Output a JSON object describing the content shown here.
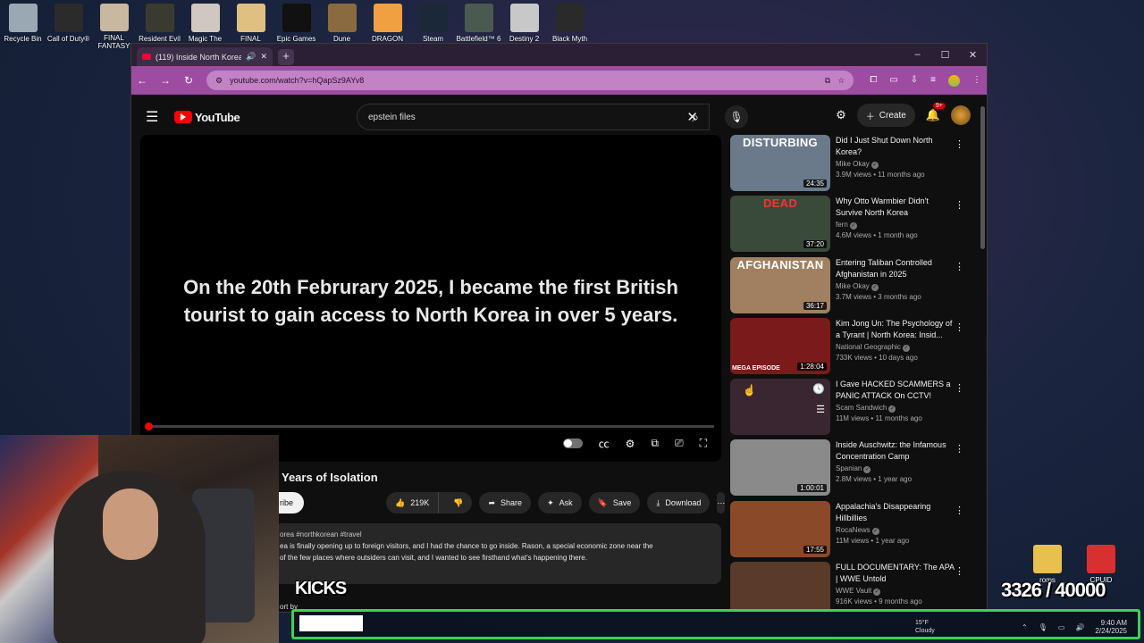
{
  "desktop": {
    "icons": [
      {
        "label": "Recycle Bin",
        "color": "#9aa8b4"
      },
      {
        "label": "Call of Duty®",
        "color": "#2b2b2b"
      },
      {
        "label": "FINAL FANTASY",
        "color": "#c8b8a0"
      },
      {
        "label": "Resident Evil",
        "color": "#3a3a30"
      },
      {
        "label": "Magic The",
        "color": "#d0c8c0"
      },
      {
        "label": "FINAL",
        "color": "#e0c080"
      },
      {
        "label": "Epic Games",
        "color": "#111111"
      },
      {
        "label": "Dune",
        "color": "#8a6a40"
      },
      {
        "label": "DRAGON",
        "color": "#f0a040"
      },
      {
        "label": "Steam",
        "color": "#1b2838"
      },
      {
        "label": "Battlefield™ 6",
        "color": "#4a5a50"
      },
      {
        "label": "Destiny 2",
        "color": "#c8c8c8"
      },
      {
        "label": "Black Myth",
        "color": "#2a2a2a"
      }
    ],
    "right_icons": [
      {
        "label": "roms",
        "color": "#e8c050"
      },
      {
        "label": "CPUID",
        "color": "#d83030"
      }
    ]
  },
  "browser": {
    "tab_title": "(119) Inside North Korea A",
    "new_tab": "+",
    "url": "youtube.com/watch?v=hQapSz9AYv8",
    "window_controls": [
      "–",
      "☐",
      "✕"
    ]
  },
  "youtube": {
    "logo": "YouTube",
    "search_value": "epstein files",
    "create_label": "Create",
    "notif_badge": "9+",
    "player": {
      "caption_line1": "On the 20th Februrary 2025, I became the first British",
      "caption_line2": "tourist to gain access to North Korea in over 5 years.",
      "progress": 0.0
    },
    "video_title_partial": "Years of Isolation",
    "subscribe_partial": "ribe",
    "likes": "219K",
    "share": "Share",
    "ask": "Ask",
    "save": "Save",
    "download": "Download",
    "description": {
      "tags": "orea #northkorean #travel",
      "line1": "ea is finally opening up to foreign visitors, and I had the chance to go inside. Rason, a special economic zone near the",
      "line2": "of the few places where outsiders can visit, and I wanted to see firsthand what's happening there."
    },
    "sort_by_partial": "ort by",
    "recommendations": [
      {
        "title": "Did I Just Shut Down North Korea?",
        "channel": "Mike Okay",
        "views": "3.9M views",
        "age": "11 months ago",
        "duration": "24:35",
        "thumb_text": "DISTURBING",
        "thumb_text_color": "#ffffff",
        "thumb_bg": "#6a7a8a"
      },
      {
        "title": "Why Otto Warmbier Didn't Survive North Korea",
        "channel": "fern",
        "views": "4.6M views",
        "age": "1 month ago",
        "duration": "37:20",
        "thumb_text": "DEAD",
        "thumb_text_color": "#ff3030",
        "thumb_bg": "#3a4a3a"
      },
      {
        "title": "Entering Taliban Controlled Afghanistan in 2025",
        "channel": "Mike Okay",
        "views": "3.7M views",
        "age": "3 months ago",
        "duration": "36:17",
        "thumb_text": "AFGHANISTAN",
        "thumb_text_color": "#ffffff",
        "thumb_bg": "#a08060"
      },
      {
        "title": "Kim Jong Un: The Psychology of a Tyrant | North Korea: Insid...",
        "channel": "National Geographic",
        "views": "733K views",
        "age": "10 days ago",
        "duration": "1:28:04",
        "thumb_text": "",
        "thumb_label": "MEGA EPISODE",
        "thumb_text_color": "#ffffff",
        "thumb_bg": "#7a1a1a"
      },
      {
        "title": "I Gave HACKED SCAMMERS a PANIC ATTACK On CCTV!",
        "channel": "Scam Sandwich",
        "views": "11M views",
        "age": "11 months ago",
        "duration": "",
        "thumb_text": "",
        "thumb_text_color": "#ffffff",
        "thumb_bg": "#3a2630"
      },
      {
        "title": "Inside Auschwitz: the Infamous Concentration Camp",
        "channel": "Spanian",
        "views": "2.8M views",
        "age": "1 year ago",
        "duration": "1:00:01",
        "thumb_text": "",
        "thumb_text_color": "#ffffff",
        "thumb_bg": "#8a8a8a"
      },
      {
        "title": "Appalachia's Disappearing Hillbillies",
        "channel": "RocaNews",
        "views": "11M views",
        "age": "1 year ago",
        "duration": "17:55",
        "thumb_text": "",
        "thumb_text_color": "#ffffff",
        "thumb_bg": "#8a4a2a"
      },
      {
        "title": "FULL DOCUMENTARY: The APA | WWE Untold",
        "channel": "WWE Vault",
        "views": "916K views",
        "age": "9 months ago",
        "duration": "",
        "thumb_text": "",
        "thumb_label": "APA",
        "thumb_text_color": "#ff3030",
        "thumb_bg": "#5a3a2a"
      }
    ]
  },
  "stream": {
    "kicks_label": "KICKS",
    "counter": "3326 / 40000",
    "accent": "#39d353"
  },
  "taskbar": {
    "weather_temp": "15°F",
    "weather_desc": "Cloudy",
    "time": "9:40 AM",
    "date": "2/24/2025"
  }
}
